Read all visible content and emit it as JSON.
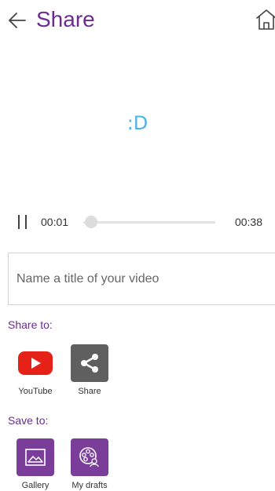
{
  "header": {
    "title": "Share",
    "back_icon": "arrow-left-icon",
    "home_icon": "home-icon"
  },
  "video": {
    "face_text": ":D"
  },
  "player": {
    "current_time": "00:01",
    "total_time": "00:38",
    "progress": 0.026
  },
  "title_input": {
    "placeholder": "Name a title of your video",
    "value": ""
  },
  "share_section": {
    "label": "Share to:",
    "items": [
      {
        "label": "YouTube",
        "icon": "youtube-icon",
        "color": "#e62117"
      },
      {
        "label": "Share",
        "icon": "share-icon",
        "color": "#5f5f5f"
      }
    ]
  },
  "save_section": {
    "label": "Save to:",
    "items": [
      {
        "label": "Gallery",
        "icon": "gallery-icon",
        "color": "#7a3d9a"
      },
      {
        "label": "My drafts",
        "icon": "drafts-icon",
        "color": "#7a3d9a"
      }
    ]
  },
  "colors": {
    "accent": "#6a2c91",
    "face": "#4fb3e6"
  }
}
